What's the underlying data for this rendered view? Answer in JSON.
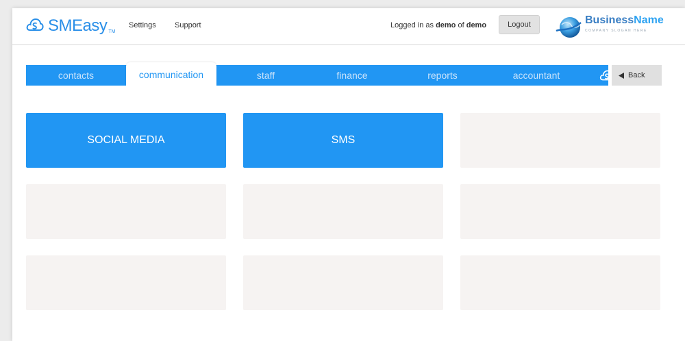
{
  "header": {
    "logo_text": "SMEasy",
    "logo_tm": "TM",
    "nav": {
      "settings": "Settings",
      "support": "Support"
    },
    "login": {
      "prefix": "Logged in as",
      "user": "demo",
      "of": "of",
      "company": "demo"
    },
    "logout_label": "Logout",
    "business": {
      "name_main": "Business",
      "name_accent": "Name",
      "slogan": "COMPANY SLOGAN HERE"
    }
  },
  "tabs": [
    {
      "label": "contacts",
      "active": false
    },
    {
      "label": "communication",
      "active": true
    },
    {
      "label": "staff",
      "active": false
    },
    {
      "label": "finance",
      "active": false
    },
    {
      "label": "reports",
      "active": false
    },
    {
      "label": "accountant",
      "active": false
    }
  ],
  "back_label": "Back",
  "tiles": [
    {
      "label": "SOCIAL MEDIA"
    },
    {
      "label": "SMS"
    }
  ],
  "colors": {
    "accent": "#2196f3",
    "tile_empty": "#f6f3f2"
  }
}
